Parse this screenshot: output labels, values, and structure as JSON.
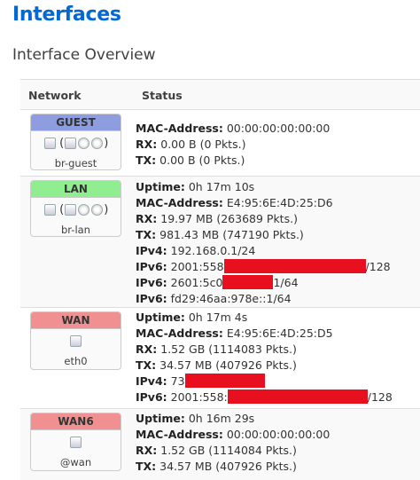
{
  "page_title": "Interfaces",
  "section_title": "Interface Overview",
  "table": {
    "col_network": "Network",
    "col_status": "Status"
  },
  "interfaces": [
    {
      "name": "GUEST",
      "color": "#8d9de0",
      "device": "br-guest",
      "status": [
        {
          "label": "MAC-Address:",
          "value": "00:00:00:00:00:00"
        },
        {
          "label": "RX:",
          "value": "0.00 B (0 Pkts.)"
        },
        {
          "label": "TX:",
          "value": "0.00 B (0 Pkts.)"
        }
      ]
    },
    {
      "name": "LAN",
      "color": "#90ee90",
      "device": "br-lan",
      "status": [
        {
          "label": "Uptime:",
          "value": "0h 17m 10s"
        },
        {
          "label": "MAC-Address:",
          "value": "E4:95:6E:4D:25:D6"
        },
        {
          "label": "RX:",
          "value": "19.97 MB (263689 Pkts.)"
        },
        {
          "label": "TX:",
          "value": "981.43 MB (747190 Pkts.)"
        },
        {
          "label": "IPv4:",
          "value": "192.168.0.1/24"
        },
        {
          "label": "IPv6:",
          "value": "2001:558",
          "suffix": "/128"
        },
        {
          "label": "IPv6:",
          "value": "2601:5c0",
          "suffix": "1/64"
        },
        {
          "label": "IPv6:",
          "value": "fd29:46aa:978e::1/64"
        }
      ]
    },
    {
      "name": "WAN",
      "color": "#f09090",
      "device": "eth0",
      "status": [
        {
          "label": "Uptime:",
          "value": "0h 17m 4s"
        },
        {
          "label": "MAC-Address:",
          "value": "E4:95:6E:4D:25:D5"
        },
        {
          "label": "RX:",
          "value": "1.52 GB (1114083 Pkts.)"
        },
        {
          "label": "TX:",
          "value": "34.57 MB (407926 Pkts.)"
        },
        {
          "label": "IPv4:",
          "value": "73"
        },
        {
          "label": "IPv6:",
          "value": "2001:558:",
          "suffix": "/128"
        }
      ]
    },
    {
      "name": "WAN6",
      "color": "#f09090",
      "device": "@wan",
      "status": [
        {
          "label": "Uptime:",
          "value": "0h 16m 29s"
        },
        {
          "label": "MAC-Address:",
          "value": "00:00:00:00:00:00"
        },
        {
          "label": "RX:",
          "value": "1.52 GB (1114084 Pkts.)"
        },
        {
          "label": "TX:",
          "value": "34.57 MB (407926 Pkts.)"
        }
      ]
    }
  ],
  "redaction_color": "#e8101e"
}
